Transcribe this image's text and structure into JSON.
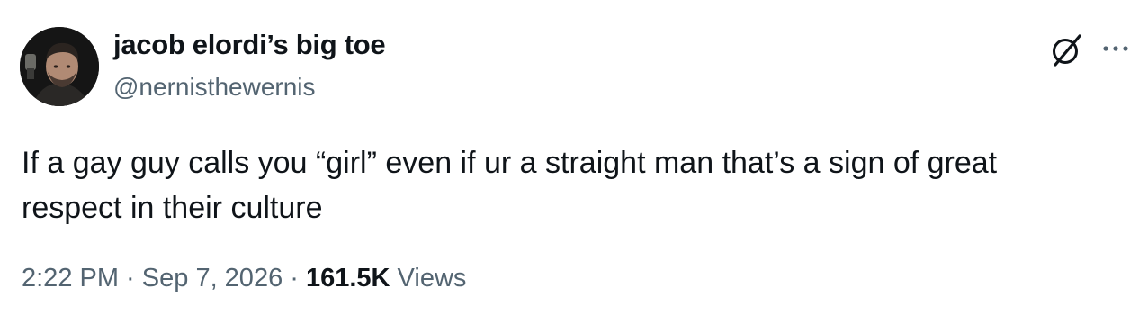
{
  "author": {
    "display_name": "jacob elordi’s big toe",
    "handle": "@nernisthewernis"
  },
  "tweet": {
    "text_line1": "If a gay guy calls you “girl” even if ur a straight man that’s a sign of great",
    "text_line2": "respect in their culture"
  },
  "meta": {
    "time": "2:22 PM",
    "separator1": " · ",
    "date": "Sep 7, 2026",
    "separator2": " · ",
    "views_count": "161.5K",
    "views_label": " Views"
  },
  "icons": {
    "grok": "grok-icon",
    "more": "more-options-icon"
  },
  "colors": {
    "text_primary": "#0f1419",
    "text_secondary": "#536471",
    "background": "#ffffff"
  }
}
